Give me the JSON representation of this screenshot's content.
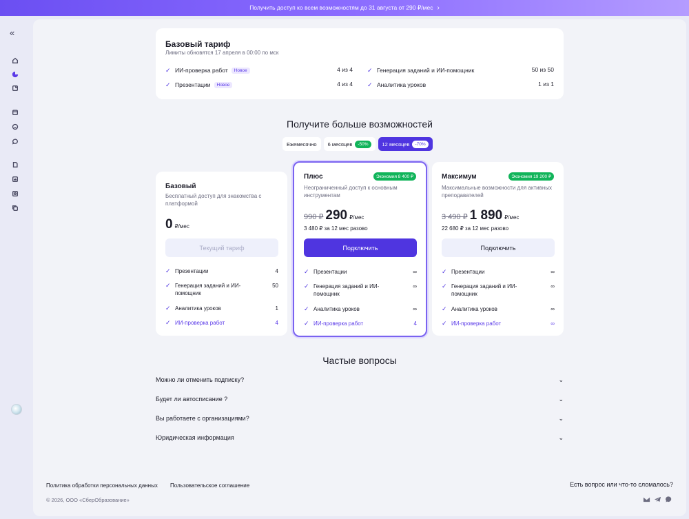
{
  "promo": {
    "text": "Получить доступ ко всем возможностям до 31 августа от 290 ₽/мес",
    "chevron": "›"
  },
  "sidebar": {
    "collapse_icon": "double-chevron-left-icon",
    "collapse_glyph": "«",
    "items": [
      "home-icon",
      "pie-chart-icon",
      "notes-icon",
      "calendar-icon",
      "smile-icon",
      "chat-icon",
      "document-icon",
      "stats-icon",
      "media-icon",
      "copy-icon"
    ]
  },
  "basic_plan": {
    "title": "Базовый тариф",
    "subtitle": "Лимиты обновятся 17 апреля в 00:00 по мск",
    "features": [
      {
        "label": "ИИ-проверка работ",
        "badge": "Новое",
        "value": "4 из 4"
      },
      {
        "label": "Презентации",
        "badge": "Новое",
        "value": "4 из 4"
      },
      {
        "label": "Генерация заданий и ИИ-помощник",
        "badge": "",
        "value": "50 из 50"
      },
      {
        "label": "Аналитика уроков",
        "badge": "",
        "value": "1 из 1"
      }
    ]
  },
  "offers": {
    "title": "Получите больше возможностей",
    "periods": [
      {
        "label": "Ежемесячно",
        "discount": ""
      },
      {
        "label": "6 месяцев",
        "discount": "-50%"
      },
      {
        "label": "12 месяцев",
        "discount": "-70%"
      }
    ],
    "active_period": 2
  },
  "plans": [
    {
      "name": "Базовый",
      "desc": "Бесплатный доступ для знакомства с платформой",
      "eco": "",
      "price_old": "",
      "price_new": "0",
      "price_unit": "₽/мес",
      "yearly": "",
      "button": "Текущий тариф",
      "features": [
        {
          "label": "Презентации",
          "value": "4"
        },
        {
          "label": "Генерация заданий и ИИ-помощник",
          "value": "50"
        },
        {
          "label": "Аналитика уроков",
          "value": "1"
        },
        {
          "label": "ИИ-проверка работ",
          "value": "4"
        }
      ]
    },
    {
      "name": "Плюс",
      "desc": "Неограниченный доступ к основным инструментам",
      "eco": "Экономия 8 400 ₽",
      "price_old": "990 ₽",
      "price_new": "290",
      "price_unit": "₽/мес",
      "yearly": "3 480 ₽ за 12 мес разово",
      "button": "Подключить",
      "features": [
        {
          "label": "Презентации",
          "value": "∞"
        },
        {
          "label": "Генерация заданий и ИИ-помощник",
          "value": "∞"
        },
        {
          "label": "Аналитика уроков",
          "value": "∞"
        },
        {
          "label": "ИИ-проверка работ",
          "value": "4"
        }
      ]
    },
    {
      "name": "Максимум",
      "desc": "Максимальные возможности для активных преподавателей",
      "eco": "Экономия 19 200 ₽",
      "price_old": "3 490 ₽",
      "price_new": "1 890",
      "price_unit": "₽/мес",
      "yearly": "22 680 ₽ за 12 мес разово",
      "button": "Подключить",
      "features": [
        {
          "label": "Презентации",
          "value": "∞"
        },
        {
          "label": "Генерация заданий и ИИ-помощник",
          "value": "∞"
        },
        {
          "label": "Аналитика уроков",
          "value": "∞"
        },
        {
          "label": "ИИ-проверка работ",
          "value": "∞"
        }
      ]
    }
  ],
  "faq": {
    "title": "Частые вопросы",
    "items": [
      "Можно ли отменить подписку?",
      "Будет ли автосписание ?",
      "Вы работаете с организациями?",
      "Юридическая информация"
    ]
  },
  "footer": {
    "privacy": "Политика обработки персональных данных",
    "terms": "Пользовательское соглашение",
    "copyright": "© 2026, ООО «СберОбразование»",
    "help": "Есть вопрос или что-то сломалось?",
    "social": [
      "mail-icon",
      "telegram-icon",
      "chat-bubble-icon"
    ]
  },
  "colors": {
    "accent": "#4f35e0",
    "success": "#11b45a",
    "background": "#f2f3f8"
  }
}
